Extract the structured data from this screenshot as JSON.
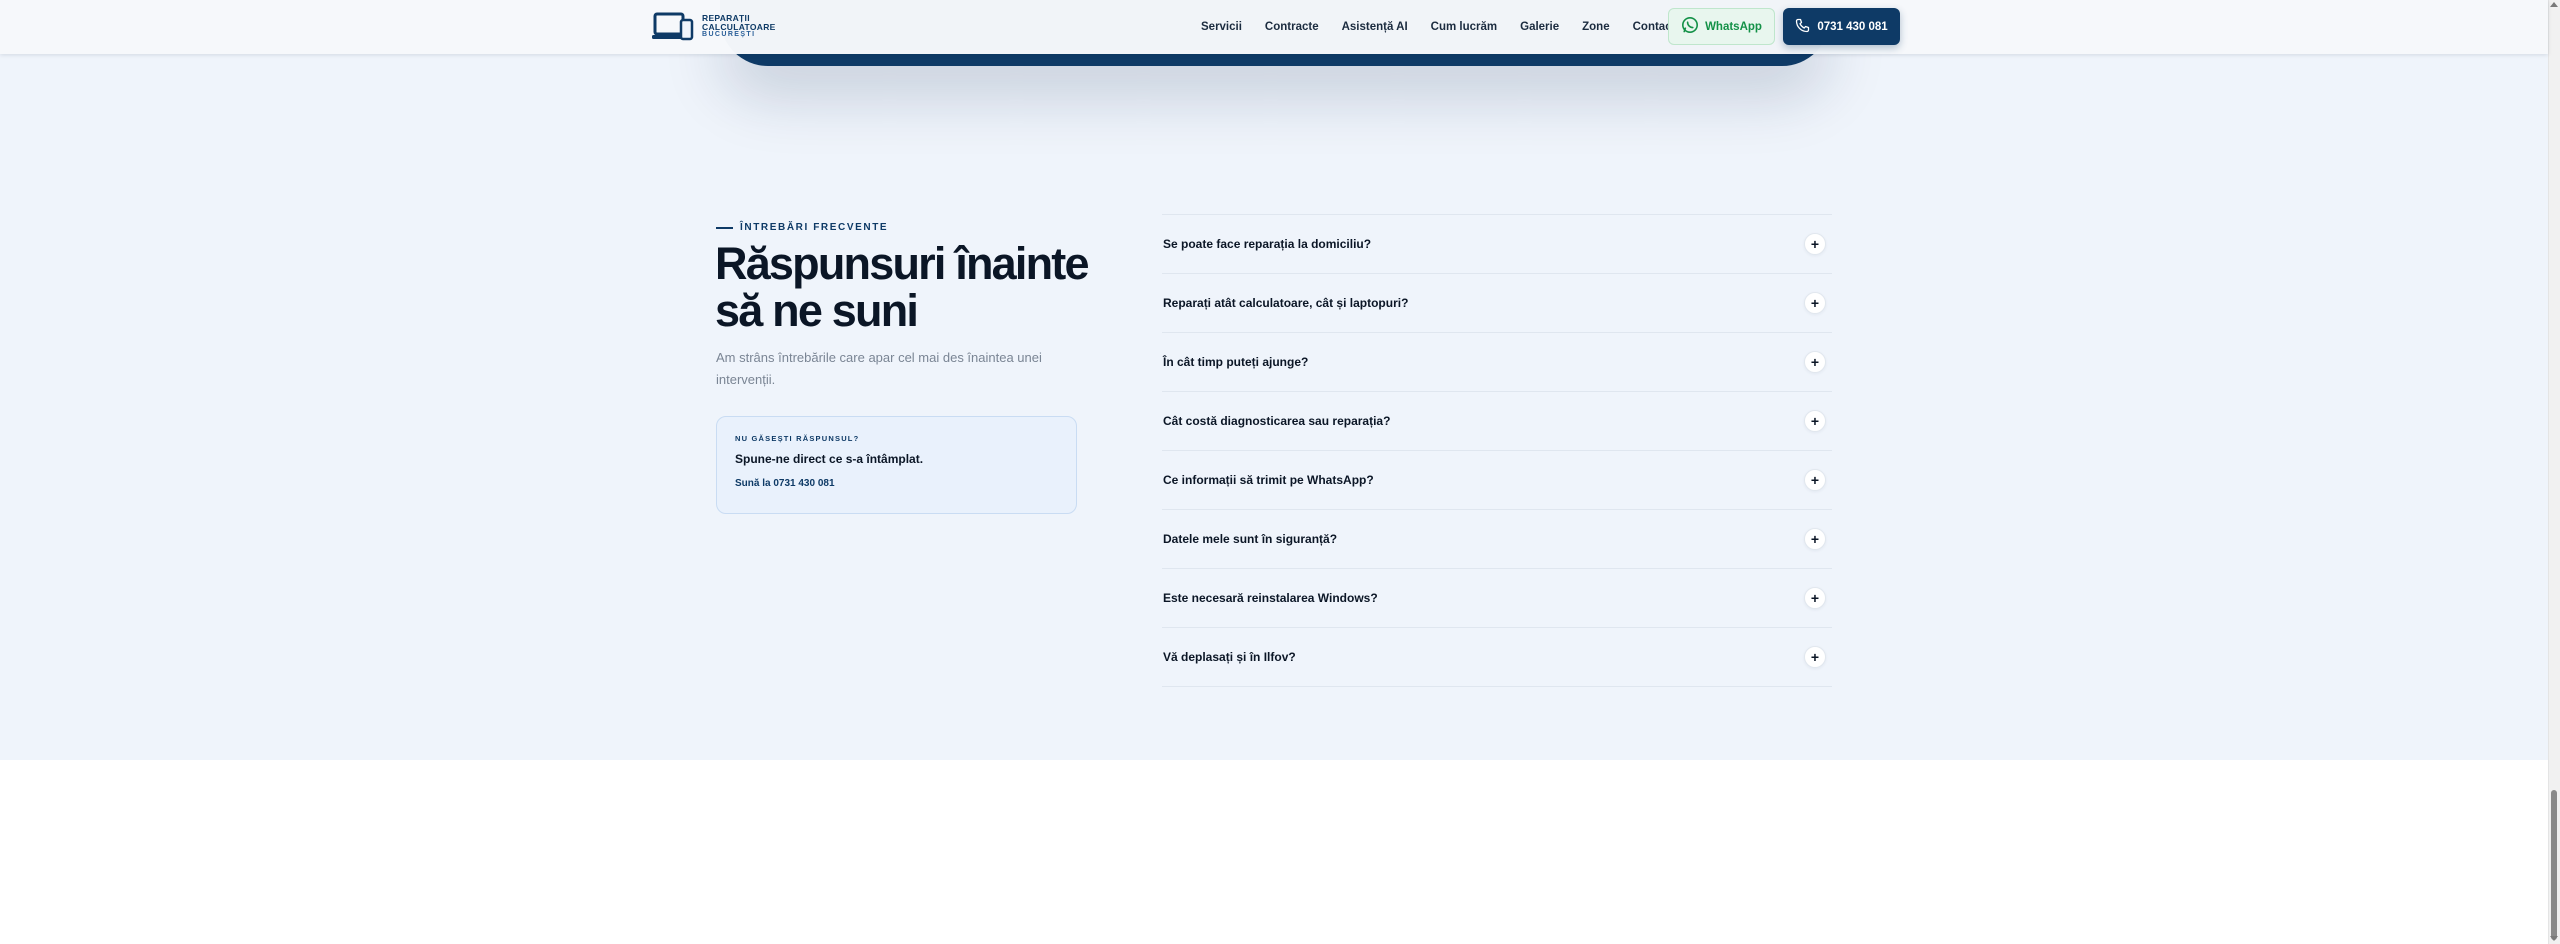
{
  "header": {
    "logo": {
      "line1": "REPARAȚII",
      "line2": "CALCULATOARE",
      "line3": "BUCUREȘTI"
    },
    "nav": [
      "Servicii",
      "Contracte",
      "Asistență AI",
      "Cum lucrăm",
      "Galerie",
      "Zone",
      "Contact"
    ],
    "whatsapp_label": "WhatsApp",
    "phone_label": "0731 430 081"
  },
  "faq_section": {
    "eyebrow": "ÎNTREBĂRI FRECVENTE",
    "title": "Răspunsuri înainte să ne suni",
    "lead": "Am strâns întrebările care apar cel mai des înaintea unei intervenții.",
    "help_card": {
      "kicker": "NU GĂSEȘTI RĂSPUNSUL?",
      "text": "Spune-ne direct ce s-a întâmplat.",
      "action": "Sună la 0731 430 081"
    },
    "questions": [
      "Se poate face reparația la domiciliu?",
      "Reparați atât calculatoare, cât și laptopuri?",
      "În cât timp puteți ajunge?",
      "Cât costă diagnosticarea sau reparația?",
      "Ce informații să trimit pe WhatsApp?",
      "Datele mele sunt în siguranță?",
      "Este necesară reinstalarea Windows?",
      "Vă deplasați și în Ilfov?"
    ],
    "expand_symbol": "+"
  },
  "colors": {
    "brand": "#0e3a66",
    "whatsapp": "#139147",
    "section_bg": "#eff4fb"
  }
}
